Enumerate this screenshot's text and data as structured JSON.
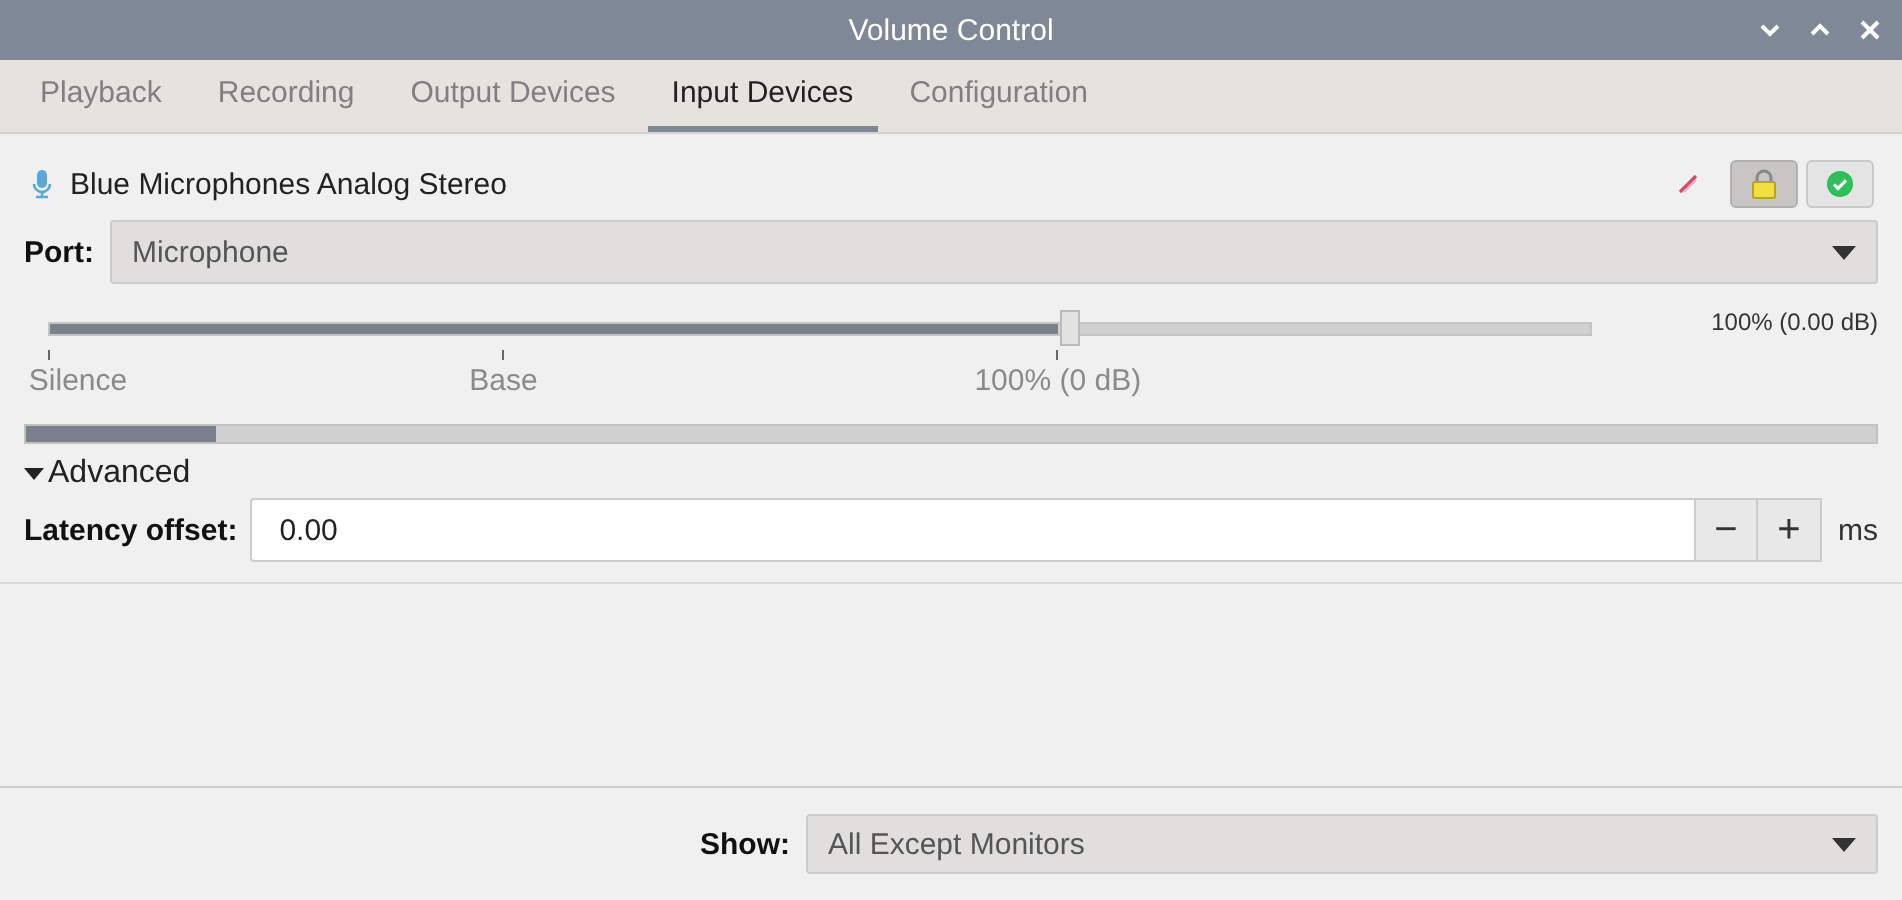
{
  "window": {
    "title": "Volume Control"
  },
  "tabs": [
    {
      "label": "Playback",
      "selected": false
    },
    {
      "label": "Recording",
      "selected": false
    },
    {
      "label": "Output Devices",
      "selected": false
    },
    {
      "label": "Input Devices",
      "selected": true
    },
    {
      "label": "Configuration",
      "selected": false
    }
  ],
  "device": {
    "name": "Blue Microphones Analog Stereo",
    "toggles": [
      {
        "kind": "mute",
        "on": false
      },
      {
        "kind": "lock",
        "on": true
      },
      {
        "kind": "default",
        "on": false
      }
    ],
    "port_label": "Port:",
    "port": "Microphone",
    "volume": {
      "level": 0.654,
      "reading": "100% (0.00 dB)",
      "marks": [
        "Silence",
        "Base",
        "100% (0 dB)"
      ]
    },
    "peak": {
      "level": 0.103
    },
    "advanced": {
      "label": "Advanced",
      "expanded": true
    },
    "latency": {
      "label": "Latency offset:",
      "value": "0.00",
      "minus": "−",
      "plus": "+",
      "unit": "ms"
    }
  },
  "footer": {
    "label": "Show:",
    "value": "All Except Monitors"
  }
}
